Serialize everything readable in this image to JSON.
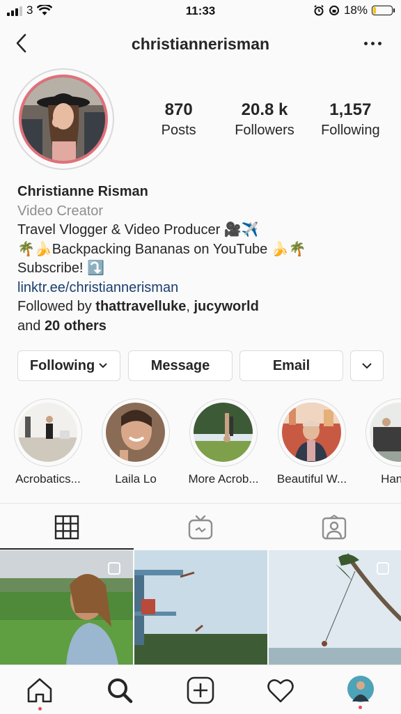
{
  "status_bar": {
    "carrier": "3",
    "time": "11:33",
    "battery_percent": "18%",
    "battery_level": 0.18,
    "battery_color": "#f5c518"
  },
  "header": {
    "username": "christiannerisman"
  },
  "stats": [
    {
      "value": "870",
      "label": "Posts"
    },
    {
      "value": "20.8 k",
      "label": "Followers"
    },
    {
      "value": "1,157",
      "label": "Following"
    }
  ],
  "bio": {
    "name": "Christianne Risman",
    "category": "Video Creator",
    "line1": "Travel Vlogger & Video Producer 🎥✈️",
    "line2": "🌴🍌Backpacking Bananas on YouTube 🍌🌴",
    "line3": "Subscribe! ⤵️",
    "link": "linktr.ee/christiannerisman",
    "followed_by_prefix": "Followed by ",
    "followed_user_1": "thattravelluke",
    "followed_sep": ", ",
    "followed_user_2": "jucyworld",
    "followed_and": "and ",
    "followed_others": "20 others"
  },
  "buttons": {
    "following": "Following",
    "message": "Message",
    "email": "Email"
  },
  "highlights": [
    {
      "label": "Acrobatics..."
    },
    {
      "label": "Laila Lo"
    },
    {
      "label": "More Acrob..."
    },
    {
      "label": "Beautiful W..."
    },
    {
      "label": "Handst"
    }
  ],
  "tabs": [
    "grid-icon",
    "igtv-icon",
    "tagged-icon"
  ],
  "bottom_nav": [
    "home-icon",
    "search-icon",
    "add-post-icon",
    "heart-icon",
    "profile-avatar"
  ],
  "colors": {
    "accent_ring": "#e0707a",
    "link": "#1a3e6e",
    "notification_dot": "#ed4956"
  }
}
